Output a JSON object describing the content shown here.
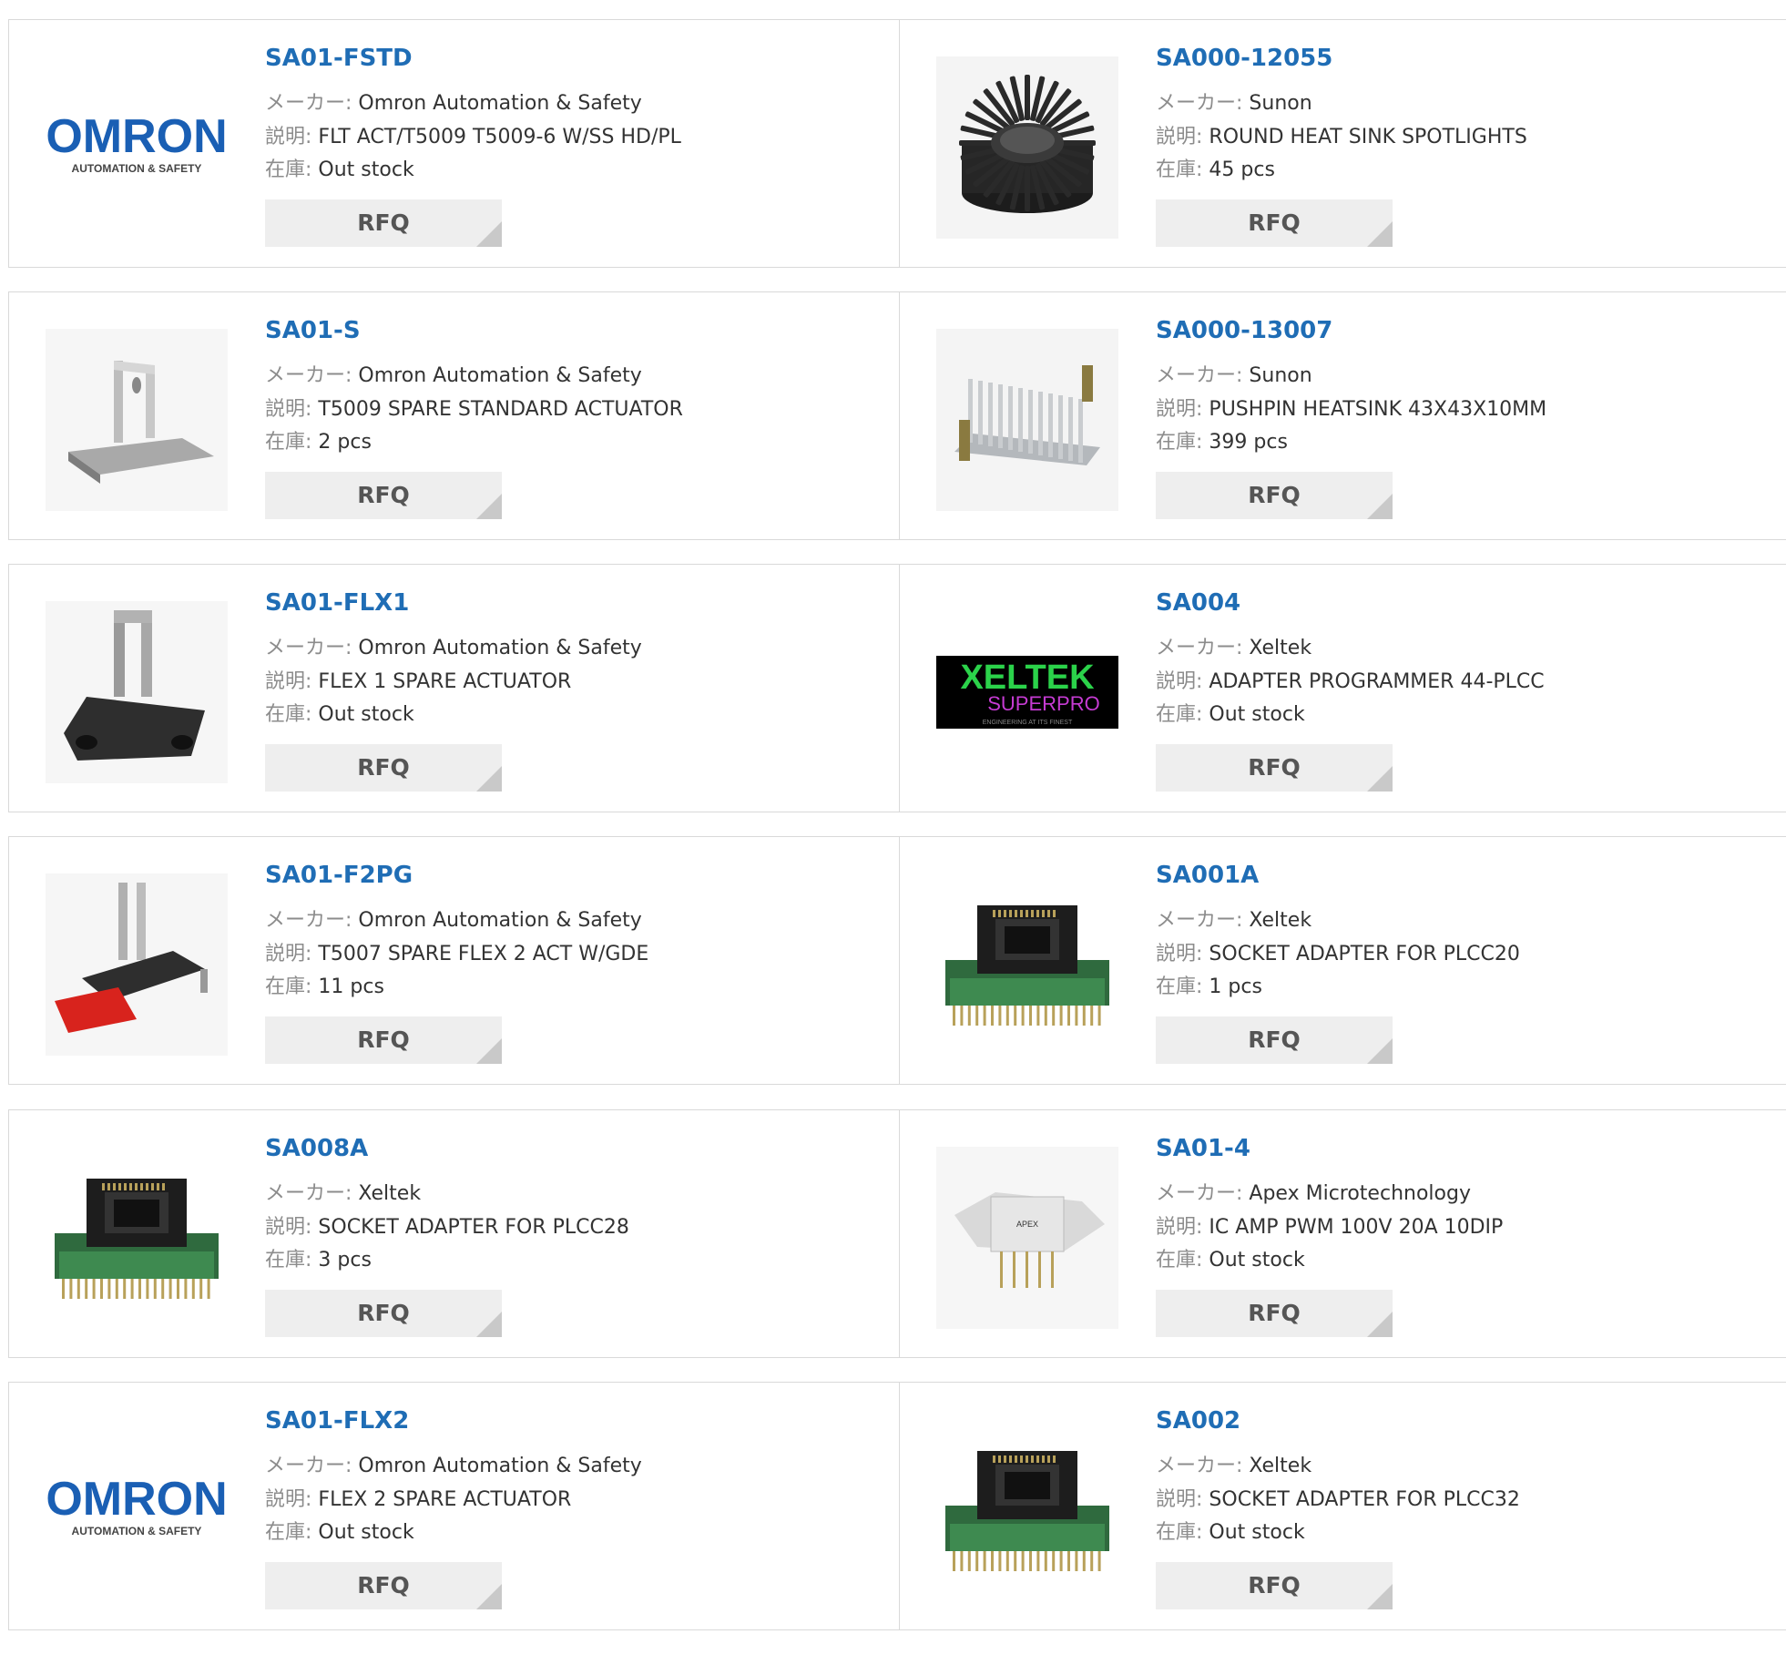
{
  "labels": {
    "maker": "メーカー:",
    "desc": "説明:",
    "stock": "在庫:",
    "rfq": "RFQ"
  },
  "brand_colors": {
    "link": "#1f6db5",
    "omron": "#1a5fb4",
    "xeltek_text": "#2bd24a",
    "xeltek_sub": "#c63bd3"
  },
  "logo_text": {
    "omron_main": "OMRON",
    "omron_sub": "AUTOMATION & SAFETY",
    "xeltek_main": "XELTEK",
    "xeltek_sub": "SUPERPRO",
    "xeltek_tag": "ENGINEERING AT ITS FINEST"
  },
  "products": [
    {
      "part": "SA01-FSTD",
      "maker": "Omron Automation & Safety",
      "desc": "FLT ACT/T5009 T5009-6 W/SS HD/PL",
      "stock": "Out stock",
      "icon": "omron-logo-icon"
    },
    {
      "part": "SA000-12055",
      "maker": "Sunon",
      "desc": "ROUND HEAT SINK SPOTLIGHTS",
      "stock": "45 pcs",
      "icon": "round-heatsink-icon"
    },
    {
      "part": "SA01-S",
      "maker": "Omron Automation & Safety",
      "desc": "T5009 SPARE STANDARD ACTUATOR",
      "stock": "2 pcs",
      "icon": "metal-actuator-icon"
    },
    {
      "part": "SA000-13007",
      "maker": "Sunon",
      "desc": "PUSHPIN HEATSINK 43X43X10MM",
      "stock": "399 pcs",
      "icon": "pushpin-heatsink-icon"
    },
    {
      "part": "SA01-FLX1",
      "maker": "Omron Automation & Safety",
      "desc": "FLEX 1 SPARE ACTUATOR",
      "stock": "Out stock",
      "icon": "flex-actuator-icon"
    },
    {
      "part": "SA004",
      "maker": "Xeltek",
      "desc": "ADAPTER PROGRAMMER 44-PLCC",
      "stock": "Out stock",
      "icon": "xeltek-logo-icon"
    },
    {
      "part": "SA01-F2PG",
      "maker": "Omron Automation & Safety",
      "desc": "T5007 SPARE FLEX 2 ACT W/GDE",
      "stock": "11 pcs",
      "icon": "flex2-actuator-icon"
    },
    {
      "part": "SA001A",
      "maker": "Xeltek",
      "desc": "SOCKET ADAPTER FOR PLCC20",
      "stock": "1 pcs",
      "icon": "socket-adapter-icon"
    },
    {
      "part": "SA008A",
      "maker": "Xeltek",
      "desc": "SOCKET ADAPTER FOR PLCC28",
      "stock": "3 pcs",
      "icon": "socket-adapter-icon"
    },
    {
      "part": "SA01-4",
      "maker": "Apex Microtechnology",
      "desc": "IC AMP PWM 100V 20A 10DIP",
      "stock": "Out stock",
      "icon": "apex-amp-icon"
    },
    {
      "part": "SA01-FLX2",
      "maker": "Omron Automation & Safety",
      "desc": "FLEX 2 SPARE ACTUATOR",
      "stock": "Out stock",
      "icon": "omron-logo-icon"
    },
    {
      "part": "SA002",
      "maker": "Xeltek",
      "desc": "SOCKET ADAPTER FOR PLCC32",
      "stock": "Out stock",
      "icon": "socket-adapter-icon"
    }
  ]
}
